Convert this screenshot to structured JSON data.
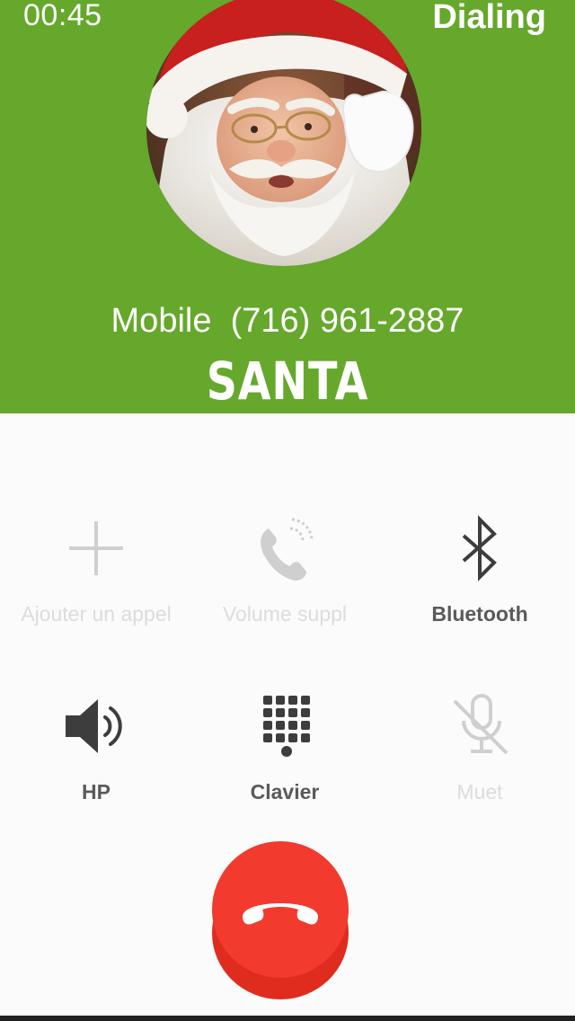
{
  "status_bar": {
    "time": "00:45",
    "call_state": "Dialing"
  },
  "caller": {
    "line": "Mobile  (716) 961-2887",
    "name": "SANTA"
  },
  "actions": [
    {
      "id": "add-call",
      "label": "Ajouter un appel",
      "icon": "plus-icon",
      "enabled": false
    },
    {
      "id": "volume",
      "label": "Volume suppl",
      "icon": "phone-volume-icon",
      "enabled": false
    },
    {
      "id": "bluetooth",
      "label": "Bluetooth",
      "icon": "bluetooth-icon",
      "enabled": true
    },
    {
      "id": "speaker",
      "label": "HP",
      "icon": "speaker-icon",
      "enabled": true
    },
    {
      "id": "keypad",
      "label": "Clavier",
      "icon": "keypad-icon",
      "enabled": true
    },
    {
      "id": "mute",
      "label": "Muet",
      "icon": "mic-off-icon",
      "enabled": false
    }
  ],
  "end_call": {
    "icon": "phone-hangup-icon",
    "color": "#e63a2b"
  },
  "colors": {
    "header_green": "#65a82b",
    "background": "#fbfbfb",
    "enabled_icon": "#3d3d3d",
    "disabled_icon": "#cfcfcf"
  }
}
